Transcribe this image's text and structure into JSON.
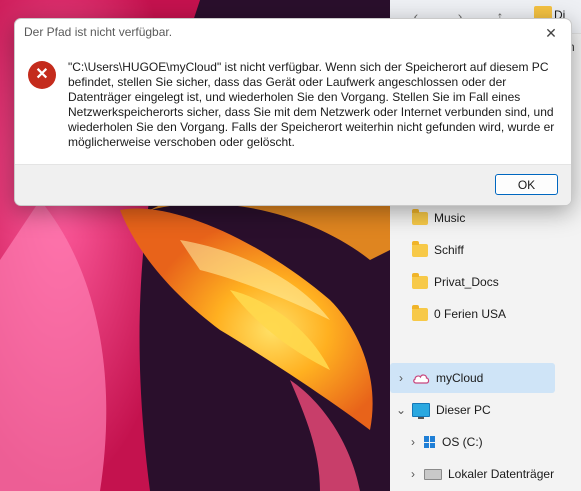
{
  "dialog": {
    "title": "Der Pfad ist nicht verfügbar.",
    "message": "\"C:\\Users\\HUGOE\\myCloud\" ist nicht verfügbar. Wenn sich der Speicherort auf diesem PC befindet, stellen Sie sicher, dass das Gerät oder Laufwerk angeschlossen oder der Datenträger eingelegt ist, und wiederholen Sie den Vorgang. Stellen Sie im Fall eines Netzwerkspeicherorts sicher, dass Sie mit dem Netzwerk oder Internet verbunden sind, und wiederholen Sie den Vorgang. Falls der Speicherort weiterhin nicht gefunden wird, wurde er möglicherweise verschoben oder gelöscht.",
    "ok_label": "OK",
    "close_glyph": "✕",
    "error_glyph": "✕"
  },
  "explorer": {
    "toolbar": {
      "back_glyph": "‹",
      "forward_glyph": "›",
      "up_glyph": "↑",
      "address_fragment": "Di"
    },
    "edge_fragment": "n",
    "nav": [
      {
        "label": "Music",
        "icon": "folder-icon"
      },
      {
        "label": "Schiff",
        "icon": "folder-icon"
      },
      {
        "label": "Privat_Docs",
        "icon": "folder-icon"
      },
      {
        "label": "0 Ferien USA",
        "icon": "folder-icon"
      },
      {
        "label": "myCloud",
        "icon": "cloud-icon",
        "chevron": "›",
        "selected": true
      },
      {
        "label": "Dieser PC",
        "icon": "pc-icon",
        "chevron": "⌄"
      },
      {
        "label": "OS (C:)",
        "icon": "os-drive-icon",
        "chevron": "›"
      },
      {
        "label": "Lokaler Datenträger",
        "icon": "drive-icon",
        "chevron": "›"
      }
    ]
  },
  "colors": {
    "error": "#c42b1c",
    "accent": "#0067c0",
    "selection": "#cfe4f7",
    "folder": "#f7c948"
  }
}
